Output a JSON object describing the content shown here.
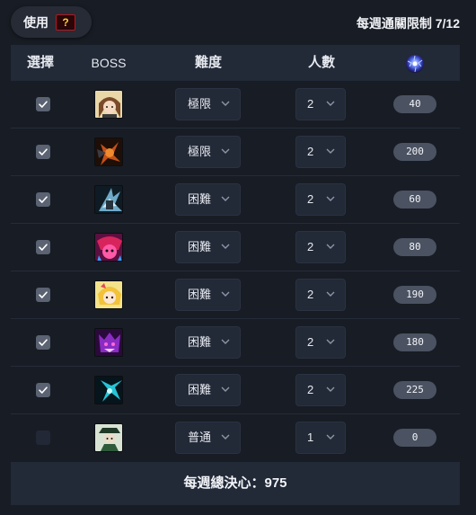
{
  "top": {
    "use_label": "使用",
    "weekly_limit": "每週通關限制 7/12"
  },
  "header": {
    "select": "選擇",
    "boss": "BOSS",
    "difficulty": "難度",
    "people": "人數",
    "crystal_icon": "crystal-orb-icon"
  },
  "bosses": [
    {
      "checked": true,
      "portrait": "boss-portrait-1-icon",
      "difficulty": "極限",
      "people": "2",
      "value": "40"
    },
    {
      "checked": true,
      "portrait": "boss-portrait-2-icon",
      "difficulty": "極限",
      "people": "2",
      "value": "200"
    },
    {
      "checked": true,
      "portrait": "boss-portrait-3-icon",
      "difficulty": "困難",
      "people": "2",
      "value": "60"
    },
    {
      "checked": true,
      "portrait": "boss-portrait-4-icon",
      "difficulty": "困難",
      "people": "2",
      "value": "80"
    },
    {
      "checked": true,
      "portrait": "boss-portrait-5-icon",
      "difficulty": "困難",
      "people": "2",
      "value": "190"
    },
    {
      "checked": true,
      "portrait": "boss-portrait-6-icon",
      "difficulty": "困難",
      "people": "2",
      "value": "180"
    },
    {
      "checked": true,
      "portrait": "boss-portrait-7-icon",
      "difficulty": "困難",
      "people": "2",
      "value": "225"
    },
    {
      "checked": false,
      "portrait": "boss-portrait-8-icon",
      "difficulty": "普通",
      "people": "1",
      "value": "0"
    }
  ],
  "footer": {
    "total": "每週總決心：975"
  },
  "colors": {
    "background": "#181c24",
    "panel": "#222937",
    "pill": "#4b5262",
    "checkbox_checked": "#5b6272"
  }
}
